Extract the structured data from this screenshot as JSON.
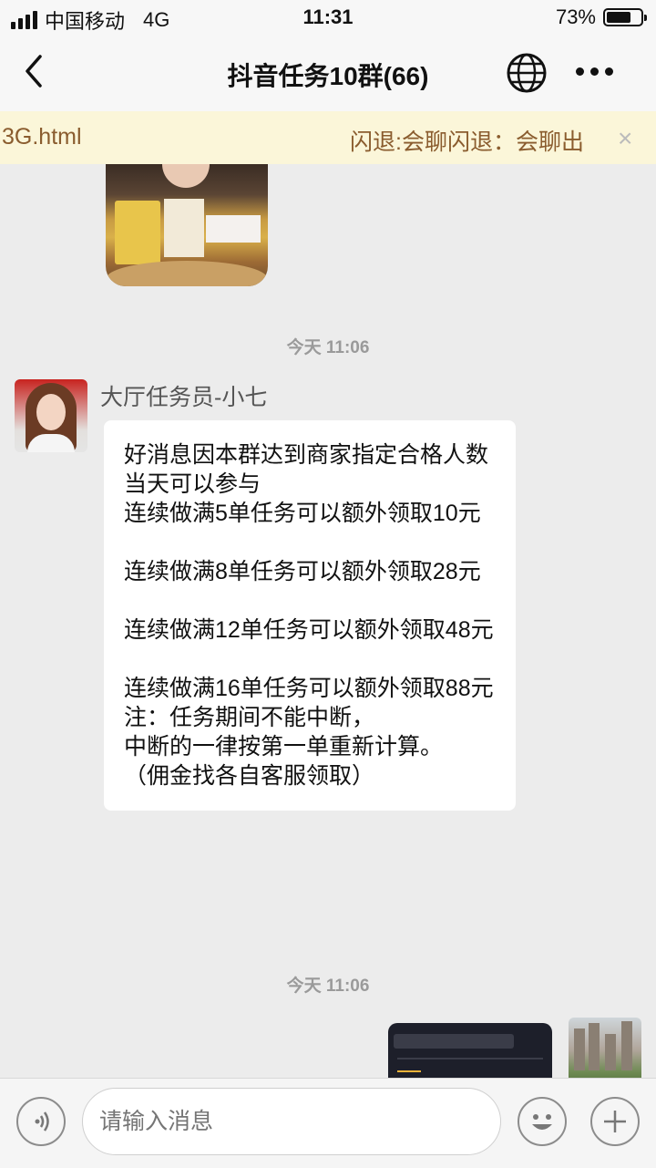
{
  "status_bar": {
    "carrier": "中国移动",
    "network": "4G",
    "time": "11:31",
    "battery_percent_label": "73%",
    "battery_level": 0.73
  },
  "nav": {
    "title": "抖音任务10群(66)",
    "icons": [
      "back-icon",
      "globe-icon",
      "more-icon"
    ]
  },
  "notice": {
    "left_text": "3G.html",
    "right_text": "闪退:会聊闪退：会聊出",
    "close_symbol": "×"
  },
  "chat": {
    "timestamps": [
      "今天 11:06",
      "今天 11:06"
    ],
    "message": {
      "sender": "大厅任务员-小七",
      "text": "好消息因本群达到商家指定合格人数当天可以参与\n连续做满5单任务可以额外领取10元\n\n连续做满8单任务可以额外领取28元\n\n连续做满12单任务可以额外领取48元\n\n连续做满16单任务可以额外领取88元\n注：任务期间不能中断，\n中断的一律按第一单重新计算。\n（佣金找各自客服领取）"
    }
  },
  "input_bar": {
    "placeholder": "请输入消息",
    "icons": [
      "voice-icon",
      "emoji-icon",
      "plus-icon"
    ]
  },
  "colors": {
    "background": "#ececec",
    "notice_bg": "#fbf6d9",
    "notice_text": "#8a5c2e",
    "bubble_bg": "#ffffff"
  }
}
